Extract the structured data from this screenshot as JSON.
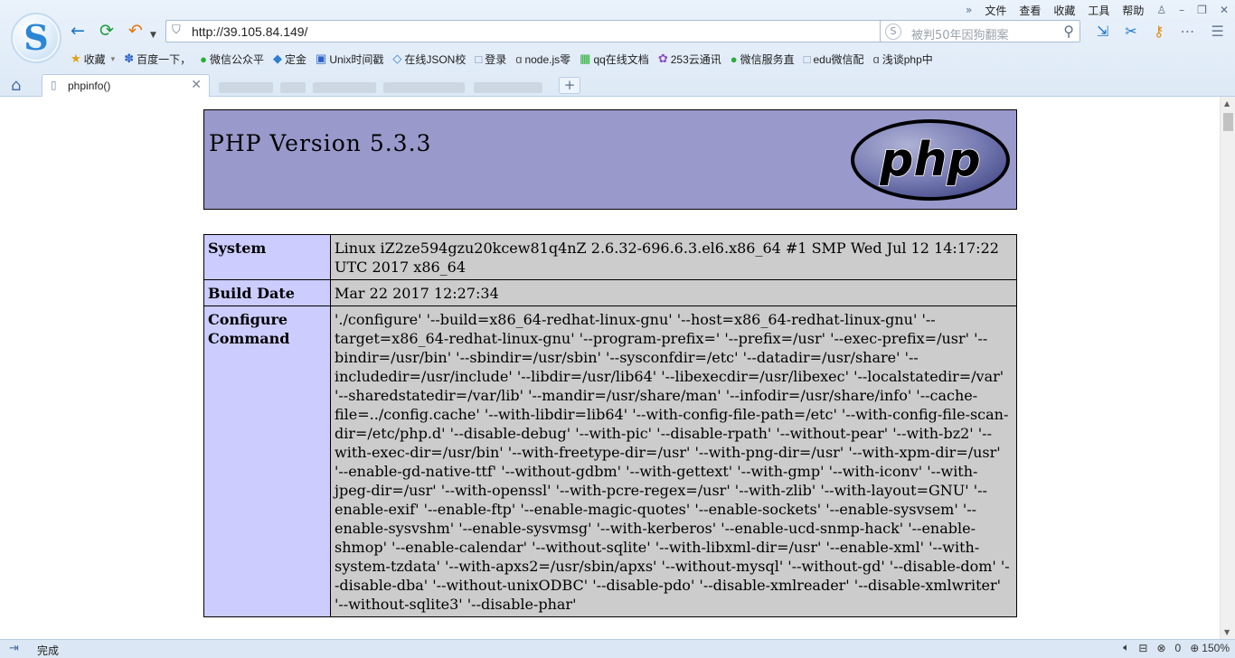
{
  "browser": {
    "logo_glyph": "S",
    "menu": [
      "文件",
      "查看",
      "收藏",
      "工具",
      "帮助"
    ],
    "nav": {
      "back_icon": "←",
      "refresh_icon": "⟳",
      "undo_icon": "↶"
    },
    "address": {
      "url": "http://39.105.84.149/"
    },
    "search": {
      "placeholder": "被判50年因狗翻案"
    },
    "bookmarks": [
      {
        "icon": "★",
        "label": "收藏",
        "color": "#e0a010"
      },
      {
        "icon": "✽",
        "label": "百度一下，",
        "color": "#2d63c8"
      },
      {
        "icon": "●",
        "label": "微信公众平",
        "color": "#2aae35"
      },
      {
        "icon": "◆",
        "label": "定金",
        "color": "#2d7fd0"
      },
      {
        "icon": "▣",
        "label": "Unix时间戳",
        "color": "#2d63c8"
      },
      {
        "icon": "◇",
        "label": "在线JSON校",
        "color": "#2d7fd0"
      },
      {
        "icon": "□",
        "label": "登录",
        "color": "#7b8fa8"
      },
      {
        "icon": "ɑ",
        "label": "node.js零",
        "color": "#555555"
      },
      {
        "icon": "▦",
        "label": "qq在线文档",
        "color": "#2aae35"
      },
      {
        "icon": "✿",
        "label": "253云通讯",
        "color": "#8a4fc8"
      },
      {
        "icon": "●",
        "label": "微信服务直",
        "color": "#2aae35"
      },
      {
        "icon": "□",
        "label": "edu微信配",
        "color": "#7b8fa8"
      },
      {
        "icon": "ɑ",
        "label": "浅谈php中",
        "color": "#555555"
      }
    ],
    "tabs": [
      {
        "title": "phpinfo()"
      }
    ],
    "status": {
      "text": "完成",
      "count": "0",
      "zoom": "150%"
    }
  },
  "php": {
    "title": "PHP Version 5.3.3",
    "logo_text": "php",
    "rows": [
      {
        "key": "System",
        "value": "Linux iZ2ze594gzu20kcew81q4nZ 2.6.32-696.6.3.el6.x86_64 #1 SMP Wed Jul 12 14:17:22 UTC 2017 x86_64"
      },
      {
        "key": "Build Date",
        "value": "Mar 22 2017 12:27:34"
      },
      {
        "key": "Configure Command",
        "value": "'./configure' '--build=x86_64-redhat-linux-gnu' '--host=x86_64-redhat-linux-gnu' '--target=x86_64-redhat-linux-gnu' '--program-prefix=' '--prefix=/usr' '--exec-prefix=/usr' '--bindir=/usr/bin' '--sbindir=/usr/sbin' '--sysconfdir=/etc' '--datadir=/usr/share' '--includedir=/usr/include' '--libdir=/usr/lib64' '--libexecdir=/usr/libexec' '--localstatedir=/var' '--sharedstatedir=/var/lib' '--mandir=/usr/share/man' '--infodir=/usr/share/info' '--cache-file=../config.cache' '--with-libdir=lib64' '--with-config-file-path=/etc' '--with-config-file-scan-dir=/etc/php.d' '--disable-debug' '--with-pic' '--disable-rpath' '--without-pear' '--with-bz2' '--with-exec-dir=/usr/bin' '--with-freetype-dir=/usr' '--with-png-dir=/usr' '--with-xpm-dir=/usr' '--enable-gd-native-ttf' '--without-gdbm' '--with-gettext' '--with-gmp' '--with-iconv' '--with-jpeg-dir=/usr' '--with-openssl' '--with-pcre-regex=/usr' '--with-zlib' '--with-layout=GNU' '--enable-exif' '--enable-ftp' '--enable-magic-quotes' '--enable-sockets' '--enable-sysvsem' '--enable-sysvshm' '--enable-sysvmsg' '--with-kerberos' '--enable-ucd-snmp-hack' '--enable-shmop' '--enable-calendar' '--without-sqlite' '--with-libxml-dir=/usr' '--enable-xml' '--with-system-tzdata' '--with-apxs2=/usr/sbin/apxs' '--without-mysql' '--without-gd' '--disable-dom' '--disable-dba' '--without-unixODBC' '--disable-pdo' '--disable-xmlreader' '--disable-xmlwriter' '--without-sqlite3' '--disable-phar'"
      }
    ]
  }
}
